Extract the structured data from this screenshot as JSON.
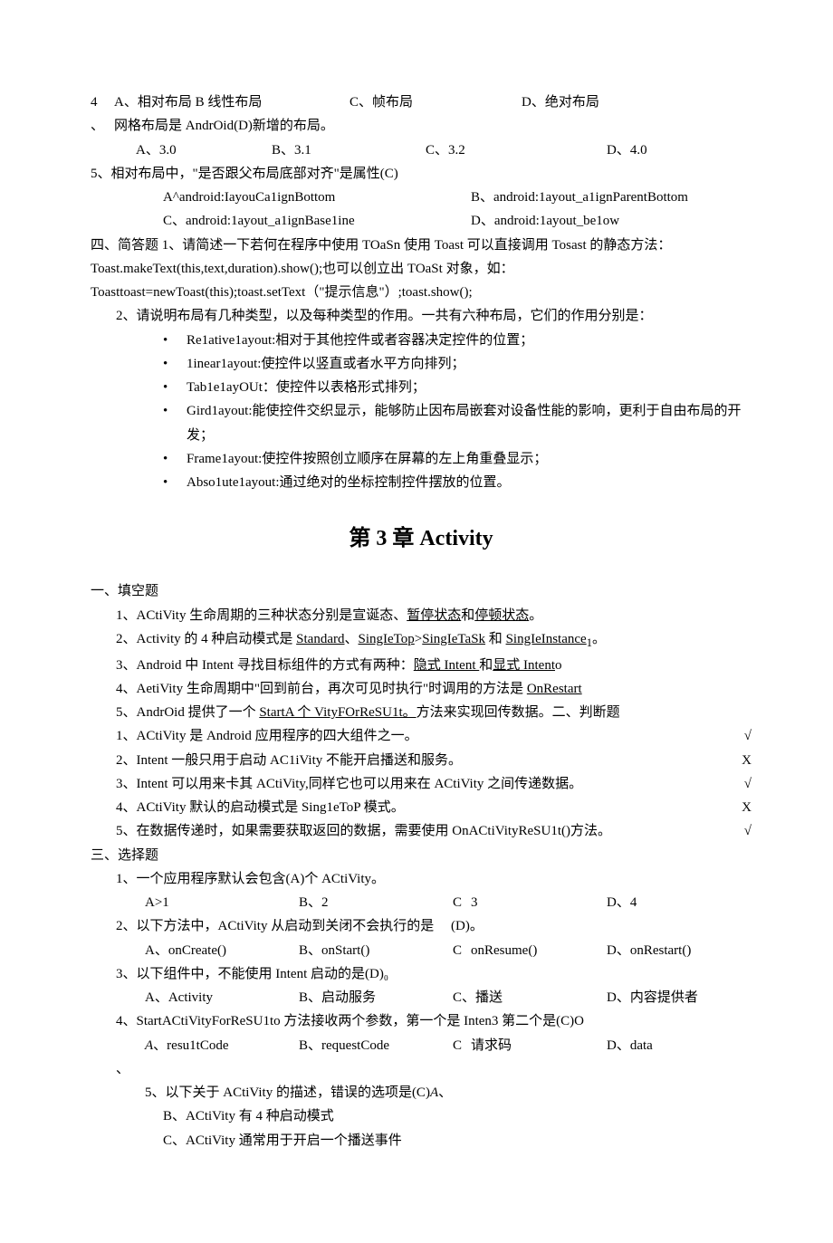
{
  "top": {
    "q4num": "4",
    "q4line1": "A、相对布局 B 线性布局",
    "q4c": "C、帧布局",
    "q4d": "D、绝对布局",
    "grid_note": "网格布局是 AndrOid(D)新增的布局。",
    "versions": {
      "a": "A、3.0",
      "b": "B、3.1",
      "c": "C、3.2",
      "d": "D、4.0"
    },
    "q5": "5、相对布局中，\"是否跟父布局底部对齐\"是属性(C)",
    "q5opts": {
      "a": "A^android:IayouCa1ignBottom",
      "b": "B、android:1ayout_a1ignParentBottom",
      "c": "C、android:1ayout_a1ignBase1ine",
      "d": "D、android:1ayout_be1ow"
    }
  },
  "sa": {
    "h": "四、简答题 1、请简述一下若何在程序中使用 TOaSn 使用 Toast 可以直接调用 Tosast 的静态方法：",
    "l2": "Toast.makeText(this,text,duration).show();也可以创立出 TOaSt 对象，如：",
    "l3": "Toasttoast=newToast(this);toast.setText（\"提示信息\"）;toast.show();",
    "q2": "2、请说明布局有几种类型，以及每种类型的作用。一共有六种布局，它们的作用分别是：",
    "bullets": [
      "Re1ative1ayout:相对于其他控件或者容器决定控件的位置；",
      "1inear1ayout:使控件以竖直或者水平方向排列；",
      "Tab1e1ayOUt：使控件以表格形式排列；",
      "Gird1ayout:能使控件交织显示，能够防止因布局嵌套对设备性能的影响，更利于自由布局的开发；",
      "Frame1ayout:使控件按照创立顺序在屏幕的左上角重叠显示；",
      "Abso1ute1ayout:通过绝对的坐标控制控件摆放的位置。"
    ]
  },
  "chapter": "第 3 章 Activity",
  "fill": {
    "h": "一、填空题",
    "q1": {
      "pre": "1、ACtiVity 生命周期的三种状态分别是宣诞态、",
      "u1": "暂停状态",
      "mid": "和",
      "u2": "停顿状态",
      "post": "。"
    },
    "q2": {
      "pre": "2、Activity 的 4 种启动模式是 ",
      "u1": "Standard",
      "s1": "、",
      "u2": "SingIeTop",
      "s2": ">",
      "u3": "SingIeTaSk",
      "s3": " 和 ",
      "u4": "SingIeInstance",
      "sub": "1",
      "post": "。"
    },
    "q3": {
      "pre": "3、Android 中 Intent 寻找目标组件的方式有两种：",
      "u1": "隐式 Intent ",
      "mid": "和",
      "u2": "显式 Intent",
      "post": "o"
    },
    "q4": {
      "pre": "4、AetiVity 生命周期中\"回到前台，再次可见时执行\"时调用的方法是 ",
      "u1": "OnRestart"
    },
    "q5": {
      "pre": "5、AndrOid 提供了一个 ",
      "u1": "StartA 个 VityFOrReSU1t。",
      "post": "方法来实现回传数据。二、判断题"
    }
  },
  "judge": [
    {
      "t": "1、ACtiVity 是 Android 应用程序的四大组件之一。",
      "a": "√"
    },
    {
      "t": "2、Intent 一般只用于启动 AC1iVity 不能开启播送和服务。",
      "a": "X"
    },
    {
      "t": "3、Intent 可以用来卡其 ACtiVity,同样它也可以用来在 ACtiVity 之间传递数据。",
      "a": "√"
    },
    {
      "t": "4、ACtiVity 默认的启动模式是 Sing1eToP 模式。",
      "a": "X"
    },
    {
      "t": "5、在数据传递时，如果需要获取返回的数据，需要使用 OnACtiVityReSU1t()方法。",
      "a": "√"
    }
  ],
  "mc": {
    "h": "三、选择题",
    "q1": "1、一个应用程序默认会包含(A)个 ACtiVity。",
    "q1o": {
      "a": "A>1",
      "b": "B、2",
      "c": "C",
      "cv": "3",
      "d": "D、4"
    },
    "q2": "2、以下方法中，ACtiVity 从启动到关闭不会执行的是",
    "q2paren": "(D)。",
    "q2o": {
      "a": "A、onCreate()",
      "b": "B、onStart()",
      "c": "C",
      "cv": "onResume()",
      "d": "D、onRestart()"
    },
    "q3": "3、以下组件中，不能使用 Intent 启动的是(D)₀",
    "q3o": {
      "a": "A、Activity",
      "b": "B、启动服务",
      "c": "C、播送",
      "d": "D、内容提供者"
    },
    "q4": "4、StartACtiVityForReSU1to 方法接收两个参数，第一个是 Inten3 第二个是(C)O",
    "q4o": {
      "a": "A、resu1tCode",
      "b": "B、requestCode",
      "c": "C",
      "cv": "请求码",
      "d": "D、data"
    },
    "trail": "、",
    "q5": "5、以下关于 ACtiVity 的描述，错误的选项是(C)A、",
    "q5b": "B、ACtiVity 有 4 种启动模式",
    "q5c": "C、ACtiVity 通常用于开启一个播送事件"
  }
}
